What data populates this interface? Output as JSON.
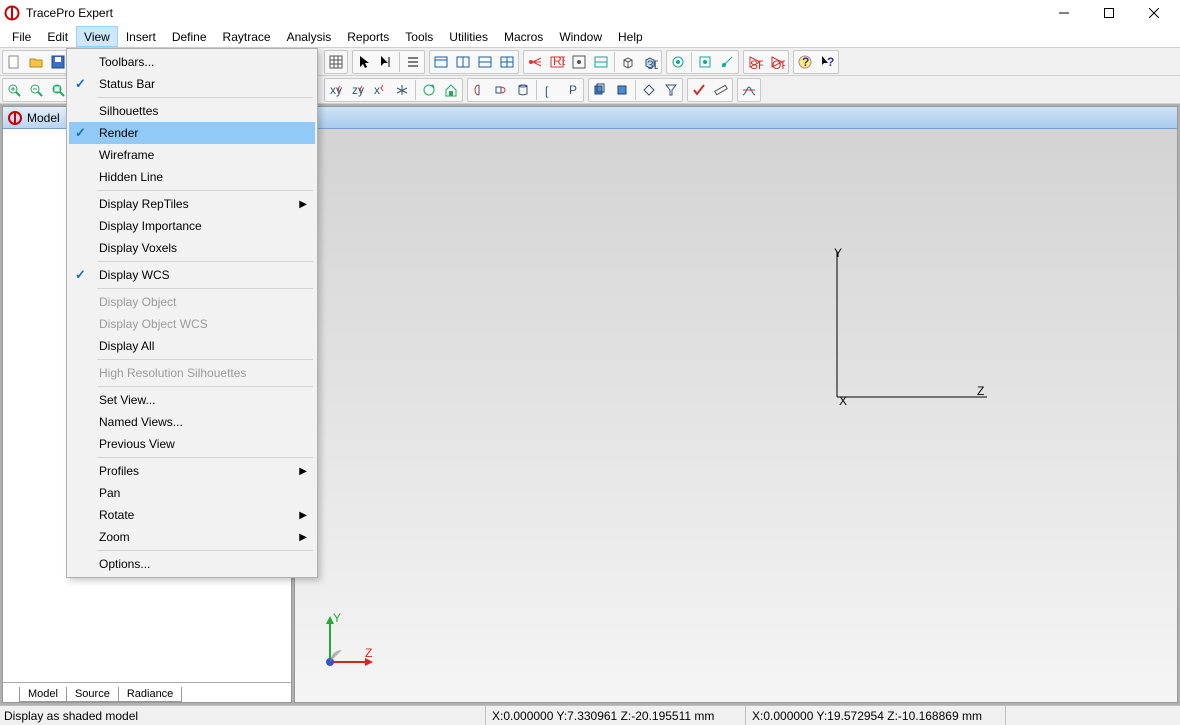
{
  "window": {
    "title": "TracePro Expert"
  },
  "menu": {
    "file": "File",
    "edit": "Edit",
    "view": "View",
    "insert": "Insert",
    "define": "Define",
    "raytrace": "Raytrace",
    "analysis": "Analysis",
    "reports": "Reports",
    "tools": "Tools",
    "utilities": "Utilities",
    "macros": "Macros",
    "windowm": "Window",
    "help": "Help"
  },
  "dropdown": {
    "toolbars": "Toolbars...",
    "statusbar": "Status Bar",
    "silhouettes": "Silhouettes",
    "render": "Render",
    "wireframe": "Wireframe",
    "hidden": "Hidden Line",
    "reptiles": "Display RepTiles",
    "importance": "Display Importance",
    "voxels": "Display Voxels",
    "wcs": "Display WCS",
    "object": "Display Object",
    "objectwcs": "Display Object WCS",
    "all": "Display All",
    "hires": "High Resolution Silhouettes",
    "setview": "Set View...",
    "named": "Named Views...",
    "previous": "Previous View",
    "profiles": "Profiles",
    "pan": "Pan",
    "rotate": "Rotate",
    "zoom": "Zoom",
    "options": "Options..."
  },
  "panel": {
    "title": "Model",
    "tabs": {
      "model": "Model",
      "source": "Source",
      "radiance": "Radiance"
    }
  },
  "axes": {
    "x": "X",
    "y": "Y",
    "z": "Z"
  },
  "status": {
    "left": "Display as shaded model",
    "coord1": "X:0.000000 Y:7.330961 Z:-20.195511 mm",
    "coord2": "X:0.000000 Y:19.572954 Z:-10.168869 mm"
  }
}
